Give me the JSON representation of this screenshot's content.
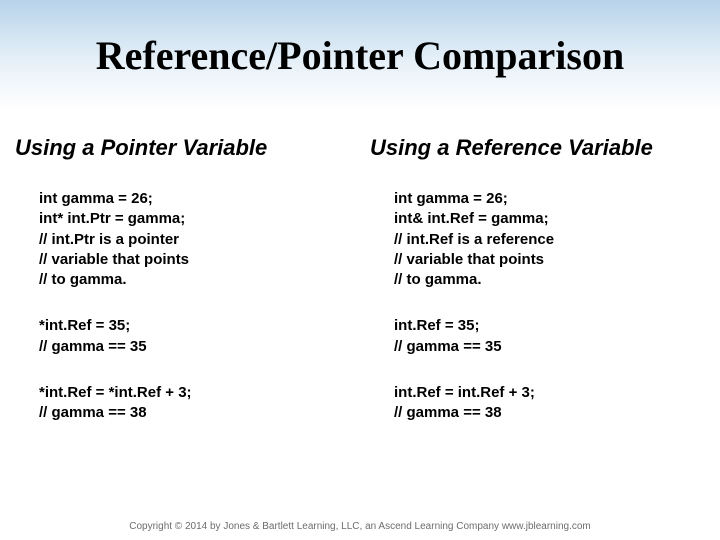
{
  "title": "Reference/Pointer Comparison",
  "left": {
    "header": "Using a Pointer Variable",
    "block1": "int gamma = 26;\nint* int.Ptr = gamma;\n// int.Ptr is a pointer\n// variable that points\n// to gamma.",
    "block2": "*int.Ref = 35;\n// gamma == 35",
    "block3": "*int.Ref = *int.Ref + 3;\n// gamma == 38"
  },
  "right": {
    "header": "Using a Reference Variable",
    "block1": "int gamma = 26;\nint& int.Ref = gamma;\n// int.Ref is a reference\n// variable that points\n// to gamma.",
    "block2": "int.Ref = 35;\n// gamma == 35",
    "block3": "int.Ref = int.Ref + 3;\n// gamma == 38"
  },
  "footer": "Copyright © 2014 by Jones & Bartlett Learning, LLC, an Ascend Learning Company\nwww.jblearning.com"
}
